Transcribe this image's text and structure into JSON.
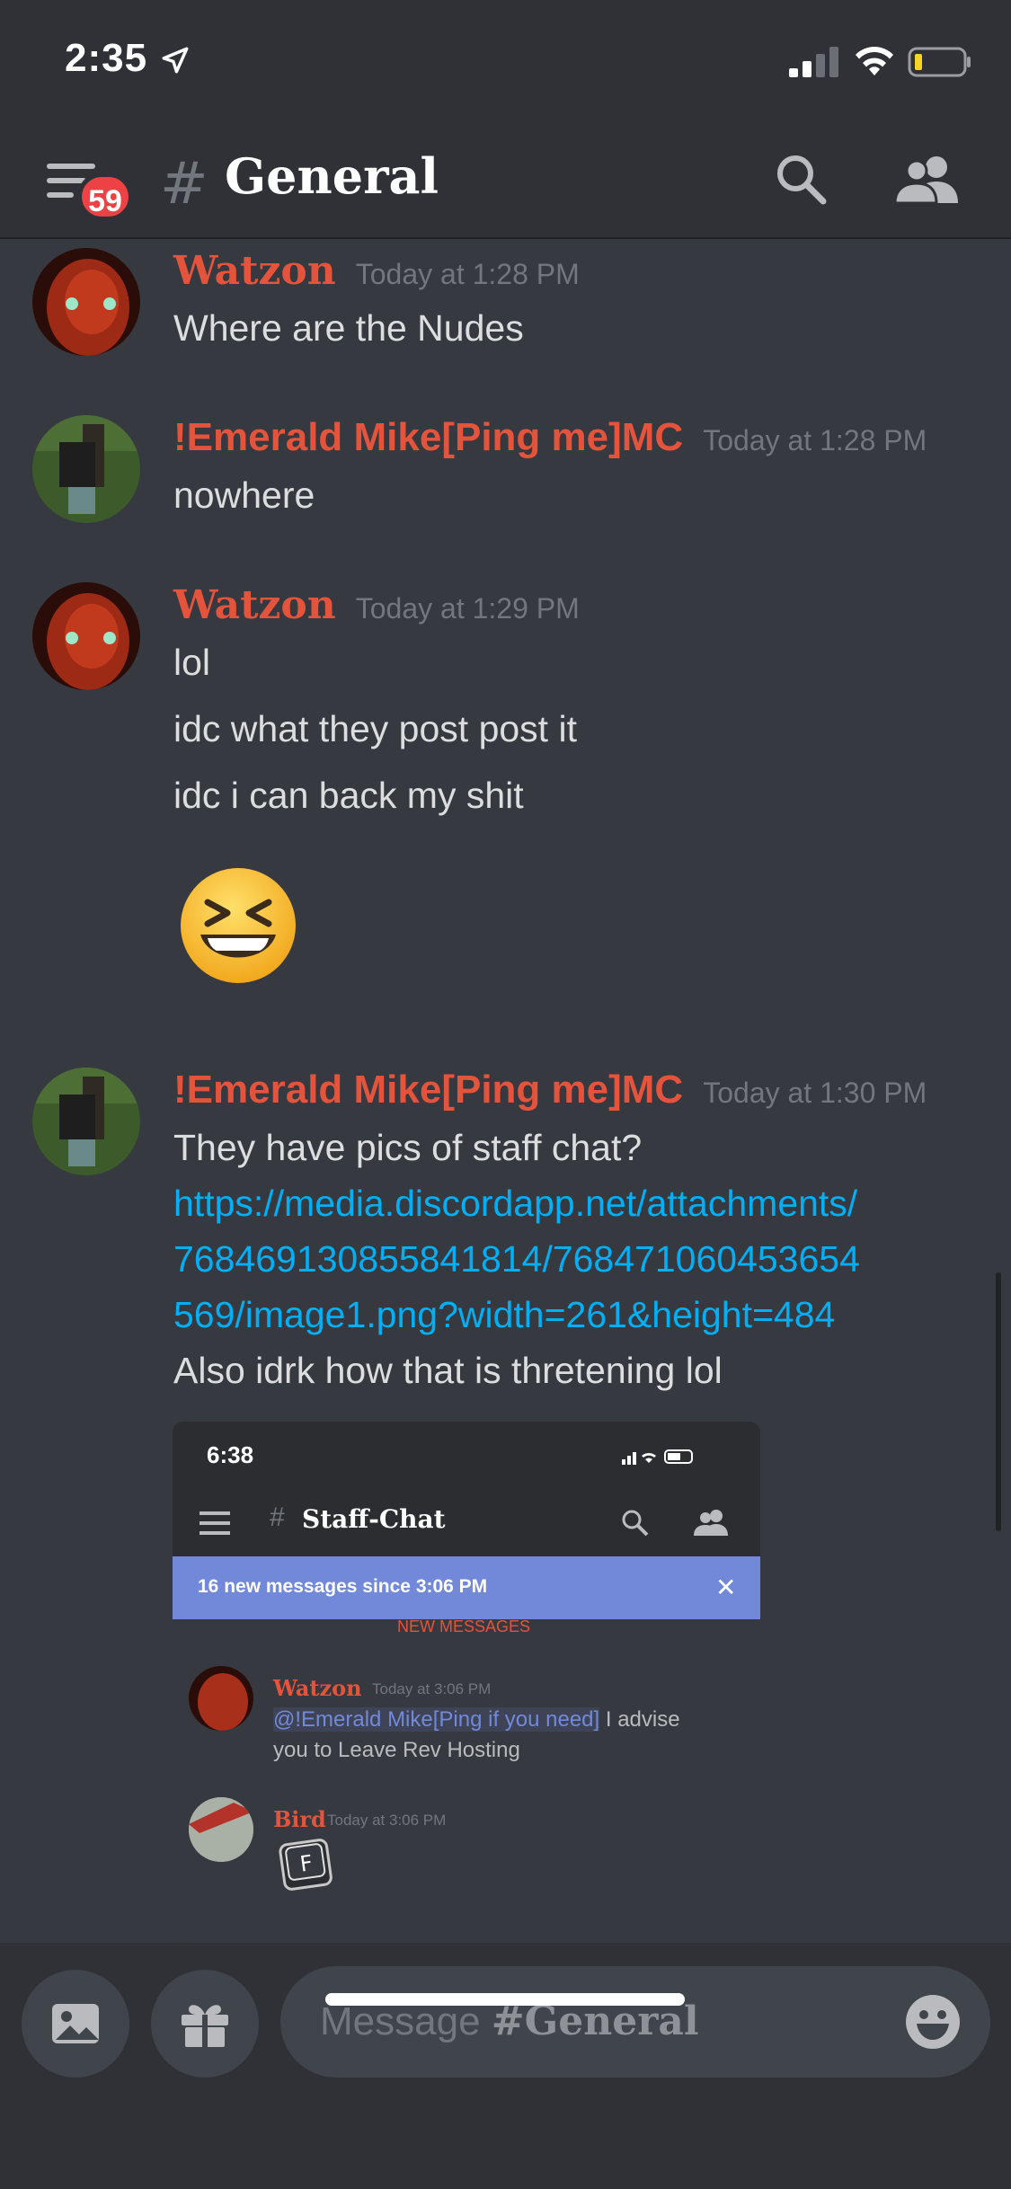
{
  "status_bar": {
    "time": "2:35"
  },
  "header": {
    "unread_count": "59",
    "hash": "#",
    "channel_name": "General"
  },
  "messages": [
    {
      "author": "Watzon",
      "timestamp": "Today at 1:28 PM",
      "lines": [
        "Where are the Nudes"
      ]
    },
    {
      "author": "!Emerald Mike[Ping me]MC",
      "timestamp": "Today at 1:28 PM",
      "lines": [
        "nowhere"
      ]
    },
    {
      "author": "Watzon",
      "timestamp": "Today at 1:29 PM",
      "lines": [
        "lol",
        "idc what they post post it",
        "idc i can back my shit"
      ]
    },
    {
      "author": "!Emerald Mike[Ping me]MC",
      "timestamp": "Today at 1:30 PM",
      "lines": [
        "They have pics of staff chat?",
        "https://media.discordapp.net/attachments/",
        "768469130855841814/768471060453654",
        "569/image1.png?width=261&height=484",
        "Also idrk how that is thretening lol"
      ]
    }
  ],
  "embed": {
    "time": "6:38",
    "hash": "#",
    "channel_name": "Staff-Chat",
    "banner": "16 new messages since 3:06 PM",
    "close": "✕",
    "new_messages_label": "NEW MESSAGES",
    "msg1": {
      "author": "Watzon",
      "timestamp": "Today at 3:06 PM",
      "mention": "@!Emerald Mike[Ping if you need]",
      "text_after": " I advise",
      "line2": "you to Leave Rev Hosting"
    },
    "msg2": {
      "author": "Bird",
      "timestamp": "Today at 3:06 PM",
      "key_letter": "F"
    }
  },
  "composer": {
    "placeholder_prefix": "Message ",
    "placeholder_channel": "#General"
  },
  "colors": {
    "background": "#36393f",
    "header": "#2f3136",
    "author": "#e4543c",
    "link": "#00aff4",
    "badge": "#ed4245",
    "banner": "#7289da"
  },
  "icons": [
    "location-arrow-icon",
    "signal-icon",
    "wifi-icon",
    "battery-icon",
    "hamburger-icon",
    "search-icon",
    "members-icon",
    "image-icon",
    "gift-icon",
    "emoji-icon",
    "grinning-squinting-emoji"
  ]
}
